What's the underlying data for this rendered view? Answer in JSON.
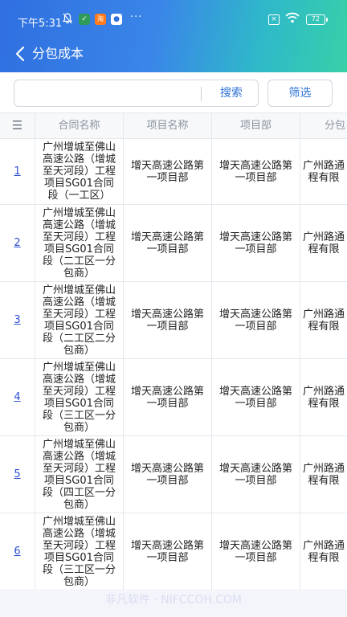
{
  "status_bar": {
    "time": "下午5:31",
    "dots": "···",
    "app_icon_2_text": "淘",
    "battery": "72"
  },
  "header": {
    "title": "分包成本"
  },
  "search": {
    "value": "",
    "placeholder": "",
    "search_label": "搜索",
    "filter_label": "筛选"
  },
  "table": {
    "columns": [
      "合同名称",
      "项目名称",
      "项目部",
      "分包"
    ],
    "rows": [
      {
        "index": "1",
        "contract_lines": [
          "广州增城至佛山",
          "高速公路（增城",
          "至天河段）工程",
          "项目SG01合同",
          "段（一工区）"
        ],
        "project_lines": [
          "增天高速公路第",
          "一项目部"
        ],
        "dept_lines": [
          "增天高速公路第",
          "一项目部"
        ],
        "sub_lines": [
          "广州路通",
          "程有限"
        ]
      },
      {
        "index": "2",
        "contract_lines": [
          "广州增城至佛山",
          "高速公路（增城",
          "至天河段）工程",
          "项目SG01合同",
          "段（二工区一分",
          "包商）"
        ],
        "project_lines": [
          "增天高速公路第",
          "一项目部"
        ],
        "dept_lines": [
          "增天高速公路第",
          "一项目部"
        ],
        "sub_lines": [
          "广州路通",
          "程有限"
        ]
      },
      {
        "index": "3",
        "contract_lines": [
          "广州增城至佛山",
          "高速公路（增城",
          "至天河段）工程",
          "项目SG01合同",
          "段（二工区二分",
          "包商）"
        ],
        "project_lines": [
          "增天高速公路第",
          "一项目部"
        ],
        "dept_lines": [
          "增天高速公路第",
          "一项目部"
        ],
        "sub_lines": [
          "广州路通",
          "程有限"
        ]
      },
      {
        "index": "4",
        "contract_lines": [
          "广州增城至佛山",
          "高速公路（增城",
          "至天河段）工程",
          "项目SG01合同",
          "段（三工区一分",
          "包商）"
        ],
        "project_lines": [
          "增天高速公路第",
          "一项目部"
        ],
        "dept_lines": [
          "增天高速公路第",
          "一项目部"
        ],
        "sub_lines": [
          "广州路通",
          "程有限"
        ]
      },
      {
        "index": "5",
        "contract_lines": [
          "广州增城至佛山",
          "高速公路（增城",
          "至天河段）工程",
          "项目SG01合同",
          "段（四工区一分",
          "包商）"
        ],
        "project_lines": [
          "增天高速公路第",
          "一项目部"
        ],
        "dept_lines": [
          "增天高速公路第",
          "一项目部"
        ],
        "sub_lines": [
          "广州路通",
          "程有限"
        ]
      },
      {
        "index": "6",
        "contract_lines": [
          "广州增城至佛山",
          "高速公路（增城",
          "至天河段）工程",
          "项目SG01合同",
          "段（三工区一分",
          "包商）"
        ],
        "project_lines": [
          "增天高速公路第",
          "一项目部"
        ],
        "dept_lines": [
          "增天高速公路第",
          "一项目部"
        ],
        "sub_lines": [
          "广州路通",
          "程有限"
        ]
      }
    ]
  },
  "watermark": "非凡软件 · NIFCCOH.COM",
  "colors": {
    "accent": "#2f74d8",
    "header_start": "#2f6fe0",
    "header_end": "#37d0a8",
    "link": "#2f4fd0"
  }
}
